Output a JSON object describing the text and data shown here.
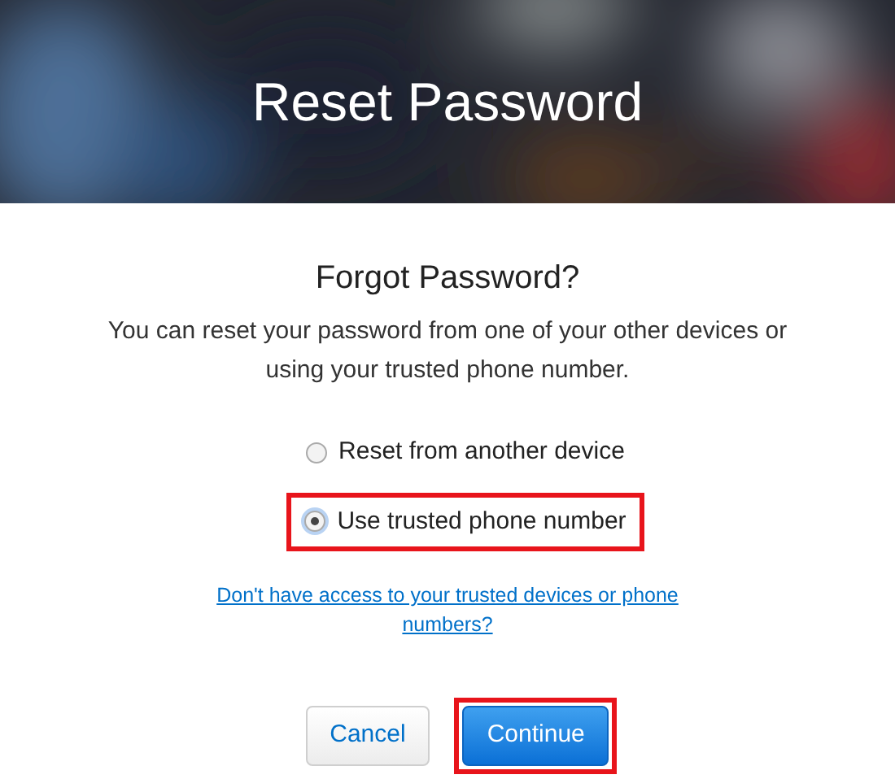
{
  "header": {
    "kind": "picture",
    "title": "Reset Password"
  },
  "heading": "Forgot Password?",
  "description": "You can reset your password from one of your other devices or using your trusted phone number.",
  "options": [
    {
      "label": "Reset from another device",
      "selected": false,
      "highlighted": false
    },
    {
      "label": "Use trusted phone number",
      "selected": true,
      "highlighted": true
    }
  ],
  "help_link": "Don't have access to your trusted devices or phone numbers?",
  "buttons": [
    {
      "label": "Cancel",
      "kind": "secondary",
      "highlighted": false
    },
    {
      "label": "Continue",
      "kind": "primary",
      "highlighted": true
    }
  ]
}
